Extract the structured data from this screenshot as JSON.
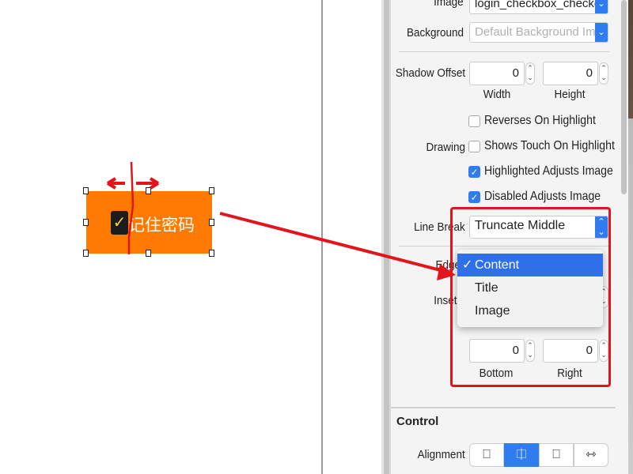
{
  "canvas": {
    "button_title": "记住密码",
    "button_color": "#ff7a00"
  },
  "inspector": {
    "image": {
      "label": "Image",
      "value": "login_checkbox_checked"
    },
    "background": {
      "label": "Background",
      "placeholder": "Default Background Image"
    },
    "shadow_offset": {
      "label": "Shadow Offset",
      "width": "0",
      "height": "0",
      "width_label": "Width",
      "height_label": "Height"
    },
    "drawing": {
      "label": "Drawing",
      "options": [
        {
          "label": "Reverses On Highlight",
          "checked": false
        },
        {
          "label": "Shows Touch On Highlight",
          "checked": false
        },
        {
          "label": "Highlighted Adjusts Image",
          "checked": true
        },
        {
          "label": "Disabled Adjusts Image",
          "checked": true
        }
      ]
    },
    "line_break": {
      "label": "Line Break",
      "value": "Truncate Middle"
    },
    "edge": {
      "label": "Edge",
      "menu": [
        {
          "label": "Content",
          "selected": true
        },
        {
          "label": "Title",
          "selected": false
        },
        {
          "label": "Image",
          "selected": false
        }
      ],
      "check": "✓"
    },
    "inset": {
      "label": "Inset",
      "bottom": "0",
      "right": "0",
      "bottom_label": "Bottom",
      "right_label": "Right"
    },
    "control": {
      "title": "Control",
      "alignment_label": "Alignment",
      "alignment_selected": 1
    }
  },
  "annotation_color": "#e3141b",
  "accent": "#2f7bf0"
}
